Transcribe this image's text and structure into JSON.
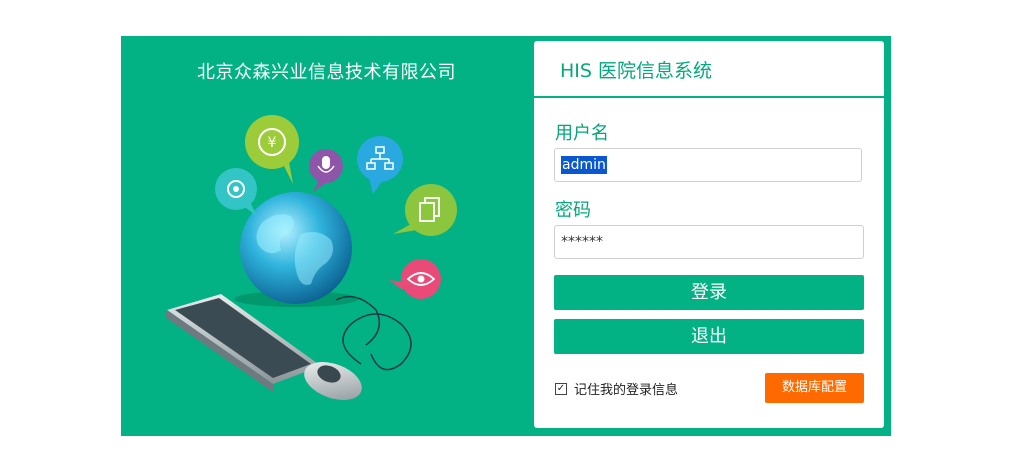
{
  "company_name": "北京众森兴业信息技术有限公司",
  "login": {
    "system_title": "HIS 医院信息系统",
    "username_label": "用户名",
    "username_value": "admin",
    "password_label": "密码",
    "password_value": "******",
    "login_button": "登录",
    "exit_button": "退出",
    "remember_label": "记住我的登录信息",
    "remember_checked": true,
    "db_config_button": "数据库配置"
  },
  "illustration": {
    "icons": [
      "gear-icon",
      "yen-icon",
      "microphone-icon",
      "sitemap-icon",
      "documents-icon",
      "eye-icon",
      "globe",
      "keyboard",
      "mouse"
    ],
    "bubble_colors": {
      "gear": "#33c5c5",
      "yen": "#9ccc3a",
      "microphone": "#8e55a8",
      "sitemap": "#2aa8e0",
      "documents": "#8cc63e",
      "eye": "#e94a77"
    }
  },
  "colors": {
    "brand_green": "#02b184",
    "text_green": "#06a57b",
    "accent_orange": "#ff6a00",
    "selection_blue": "#0a58d0"
  }
}
